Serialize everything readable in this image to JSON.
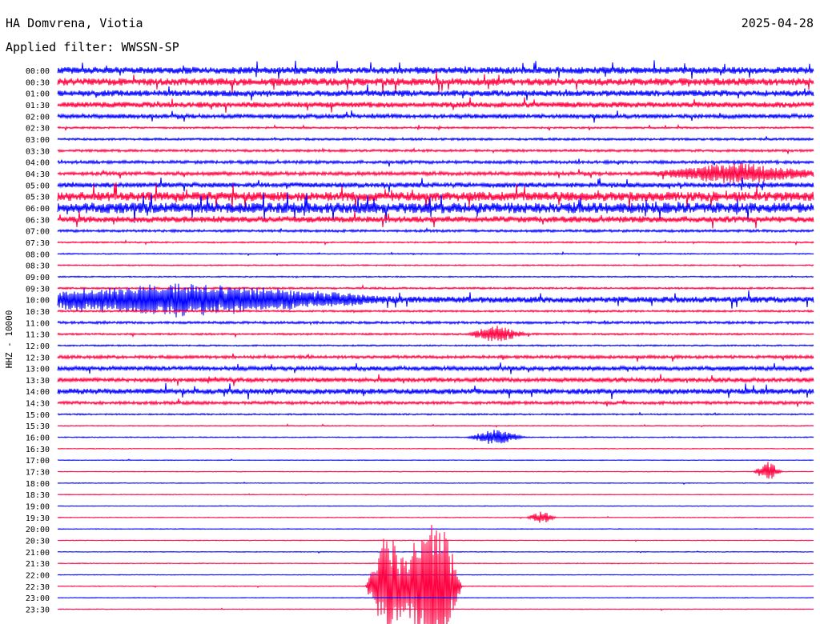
{
  "header": {
    "station": "HA Domvrena, Viotia",
    "filter": "Applied filter: WWSSN-SP",
    "date": "2025-04-28"
  },
  "chart_data": {
    "type": "line",
    "ylabel": "HHZ - 10000",
    "row_labels": [
      "00:00",
      "00:30",
      "01:00",
      "01:30",
      "02:00",
      "02:30",
      "03:00",
      "03:30",
      "04:00",
      "04:30",
      "05:00",
      "05:30",
      "06:00",
      "06:30",
      "07:00",
      "07:30",
      "08:00",
      "08:30",
      "09:00",
      "09:30",
      "10:00",
      "10:30",
      "11:00",
      "11:30",
      "12:00",
      "12:30",
      "13:00",
      "13:30",
      "14:00",
      "14:30",
      "15:00",
      "15:30",
      "16:00",
      "16:30",
      "17:00",
      "17:30",
      "18:00",
      "18:30",
      "19:00",
      "19:30",
      "20:00",
      "20:30",
      "21:00",
      "21:30",
      "22:00",
      "22:30",
      "23:00",
      "23:30"
    ],
    "colors": [
      "#0000ff",
      "#ff0040"
    ],
    "activity": [
      0.55,
      0.6,
      0.5,
      0.45,
      0.35,
      0.15,
      0.18,
      0.2,
      0.25,
      0.3,
      0.4,
      0.75,
      0.85,
      0.5,
      0.2,
      0.12,
      0.1,
      0.1,
      0.1,
      0.15,
      0.5,
      0.15,
      0.2,
      0.15,
      0.12,
      0.25,
      0.35,
      0.35,
      0.45,
      0.25,
      0.12,
      0.08,
      0.08,
      0.06,
      0.06,
      0.06,
      0.06,
      0.06,
      0.06,
      0.06,
      0.06,
      0.06,
      0.06,
      0.06,
      0.06,
      0.06,
      0.06,
      0.06
    ],
    "events": [
      {
        "row": 9,
        "x_frac": 0.9,
        "amp": 0.6,
        "width_frac": 0.12
      },
      {
        "row": 20,
        "x_frac": 0.16,
        "amp": 0.9,
        "width_frac": 0.3
      },
      {
        "row": 23,
        "x_frac": 0.58,
        "amp": 0.5,
        "width_frac": 0.04
      },
      {
        "row": 32,
        "x_frac": 0.58,
        "amp": 0.5,
        "width_frac": 0.04
      },
      {
        "row": 35,
        "x_frac": 0.94,
        "amp": 0.6,
        "width_frac": 0.02
      },
      {
        "row": 39,
        "x_frac": 0.64,
        "amp": 0.4,
        "width_frac": 0.02
      },
      {
        "row": 45,
        "x_frac": 0.437,
        "amp": 3.5,
        "width_frac": 0.03
      },
      {
        "row": 45,
        "x_frac": 0.476,
        "amp": 3.2,
        "width_frac": 0.025
      },
      {
        "row": 45,
        "x_frac": 0.505,
        "amp": 4.5,
        "width_frac": 0.03
      }
    ]
  }
}
